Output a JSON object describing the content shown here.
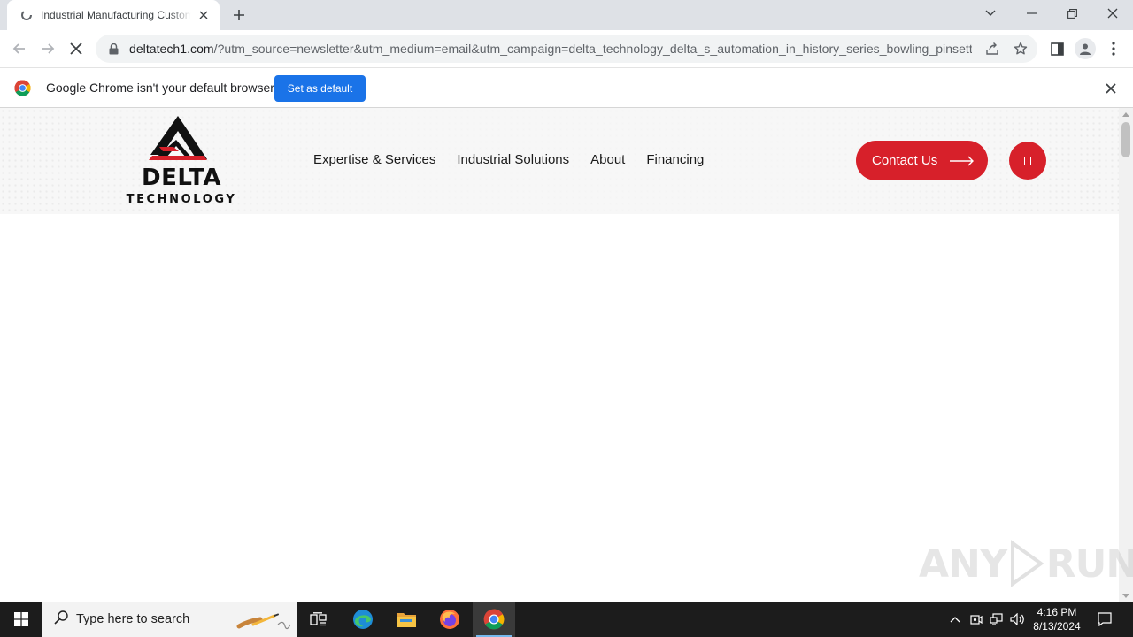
{
  "browser": {
    "tab": {
      "title": "Industrial Manufacturing Custom Solutions | Delta Technology"
    },
    "url": {
      "host": "deltatech1.com",
      "rest": "/?utm_source=newsletter&utm_medium=email&utm_campaign=delta_technology_delta_s_automation_in_history_series_bowling_pinsetter..."
    },
    "infobar": {
      "message": "Google Chrome isn't your default browser",
      "button_label": "Set as default"
    }
  },
  "site": {
    "logo": {
      "word": "DELTA",
      "sub": "TECHNOLOGY"
    },
    "nav": [
      "Expertise & Services",
      "Industrial Solutions",
      "About",
      "Financing"
    ],
    "contact_label": "Contact Us",
    "accent_color": "#d7202a"
  },
  "watermark": {
    "left": "ANY",
    "right": "RUN"
  },
  "taskbar": {
    "search_placeholder": "Type here to search",
    "time": "4:16 PM",
    "date": "8/13/2024"
  }
}
